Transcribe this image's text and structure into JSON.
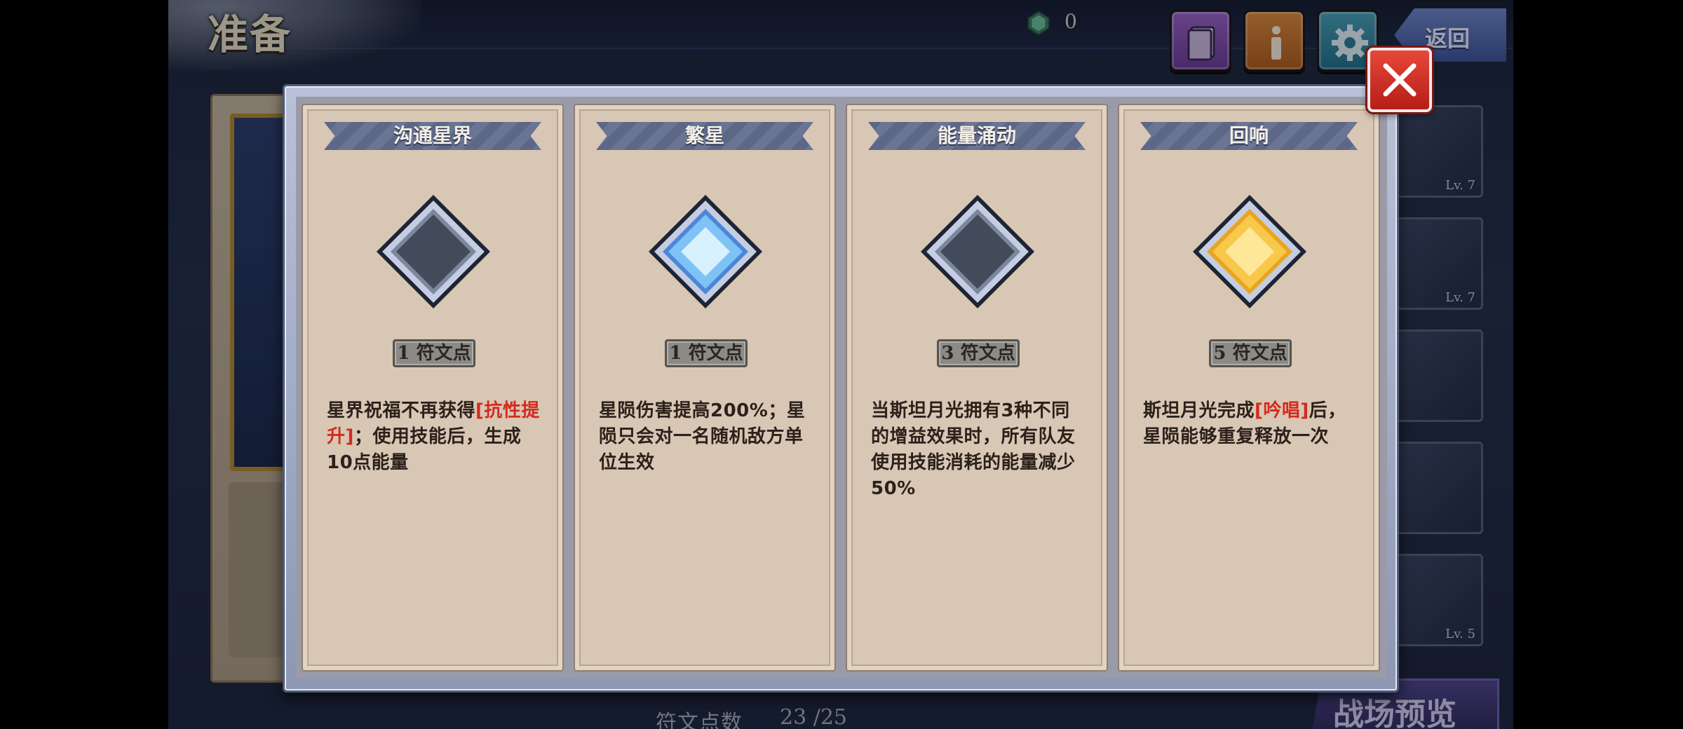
{
  "header": {
    "title": "准备",
    "gem_count": "0",
    "back_label": "返回"
  },
  "roster": [
    {
      "level": "Lv. 7"
    },
    {
      "level": "Lv. 7"
    },
    {
      "level": ""
    },
    {
      "level": ""
    },
    {
      "level": "Lv. 5"
    }
  ],
  "footer": {
    "rune_points_label": "符文点数",
    "rune_points_value": "23 /25",
    "battle_preview_label": "战场预览"
  },
  "modal": {
    "cards": [
      {
        "title": "沟通星界",
        "gem": "empty",
        "cost": "1 符文点",
        "desc_before": "星界祝福不再获得",
        "desc_highlight": "[抗性提升]",
        "desc_after": "；使用技能后，生成10点能量"
      },
      {
        "title": "繁星",
        "gem": "blue",
        "cost": "1 符文点",
        "desc_before": "星陨伤害提高200%；星陨只会对一名随机敌方单位生效",
        "desc_highlight": "",
        "desc_after": ""
      },
      {
        "title": "能量涌动",
        "gem": "empty",
        "cost": "3 符文点",
        "desc_before": "当斯坦月光拥有3种不同的增益效果时，所有队友使用技能消耗的能量减少50%",
        "desc_highlight": "",
        "desc_after": ""
      },
      {
        "title": "回响",
        "gem": "gold",
        "cost": "5 符文点",
        "desc_before": "斯坦月光完成",
        "desc_highlight": "[吟唱]",
        "desc_after": "后，星陨能够重复释放一次"
      }
    ]
  },
  "colors": {
    "highlight": "#d42a1e",
    "card_bg": "#d8c7b5",
    "close_button": "#c8261c"
  },
  "icons": {
    "gem_currency": "green-gem-icon",
    "book": "book-icon",
    "info": "info-icon",
    "settings": "gear-icon",
    "close": "close-icon"
  }
}
